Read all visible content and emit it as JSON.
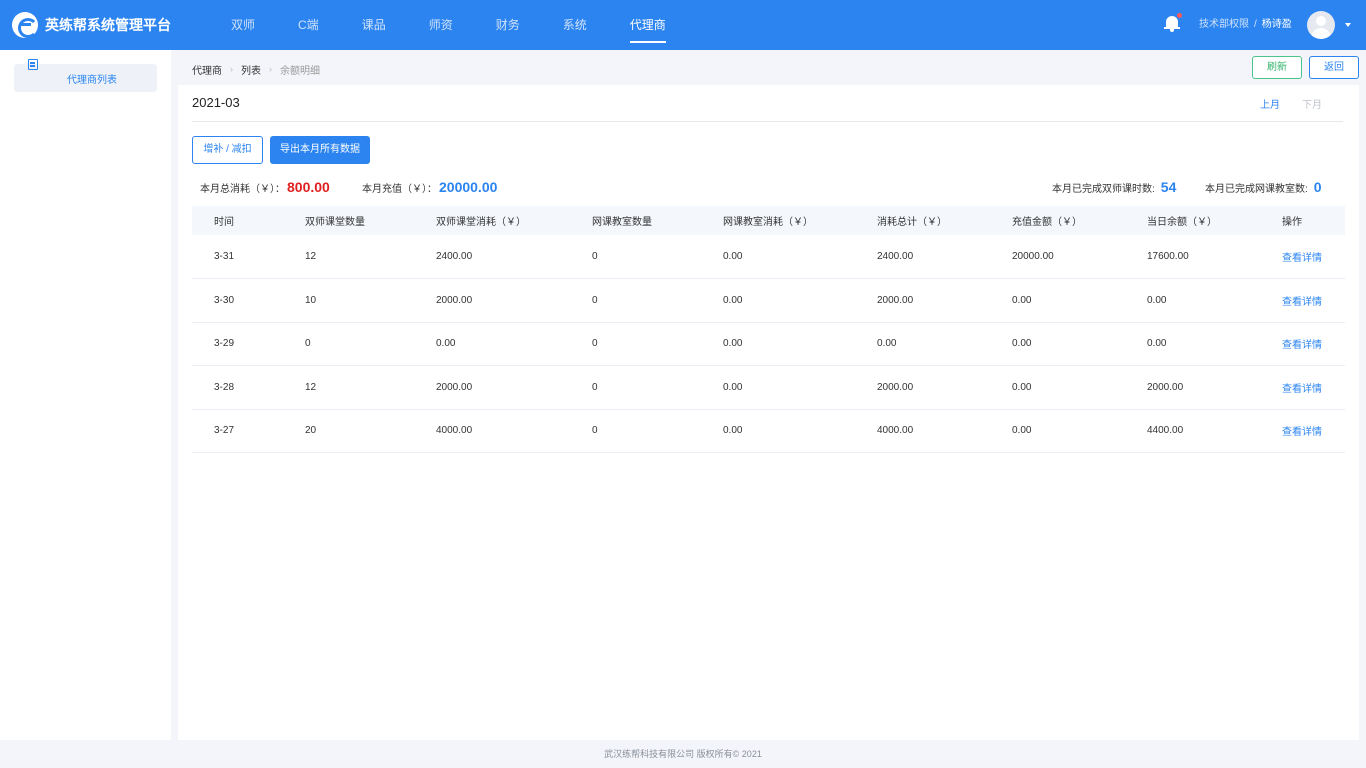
{
  "header": {
    "app_title": "英练帮系统管理平台",
    "nav": [
      {
        "label": "双师",
        "active": false
      },
      {
        "label": "C端",
        "active": false
      },
      {
        "label": "课品",
        "active": false
      },
      {
        "label": "师资",
        "active": false
      },
      {
        "label": "财务",
        "active": false
      },
      {
        "label": "系统",
        "active": false
      },
      {
        "label": "代理商",
        "active": true
      }
    ],
    "permission": "技术部权限",
    "separator": "/",
    "username": "杨诗盈"
  },
  "sidebar": {
    "items": [
      {
        "label": "代理商列表",
        "icon": "list-doc-icon"
      }
    ]
  },
  "breadcrumb": [
    "代理商",
    "列表",
    "余额明细"
  ],
  "actions": {
    "refresh": "刷新",
    "back": "返回"
  },
  "month_bar": {
    "month": "2021-03",
    "prev": "上月",
    "next": "下月"
  },
  "buttons": {
    "adjust": "增补 / 减扣",
    "export": "导出本月所有数据"
  },
  "stats": {
    "total_consume_label": "本月总消耗（￥）：",
    "total_consume_value": "800.00",
    "recharge_label": "本月充值（￥）：",
    "recharge_value": "20000.00",
    "dual_hours_label": "本月已完成双师课时数:",
    "dual_hours_value": "54",
    "online_rooms_label": "本月已完成网课教室数:",
    "online_rooms_value": "0"
  },
  "table": {
    "columns": [
      "时间",
      "双师课堂数量",
      "双师课堂消耗（￥）",
      "网课教室数量",
      "网课教室消耗（￥）",
      "消耗总计（￥）",
      "充值金额（￥）",
      "当日余额（￥）",
      "操作"
    ],
    "rows": [
      [
        "3-31",
        "12",
        "2400.00",
        "0",
        "0.00",
        "2400.00",
        "20000.00",
        "17600.00",
        "查看详情"
      ],
      [
        "3-30",
        "10",
        "2000.00",
        "0",
        "0.00",
        "2000.00",
        "0.00",
        "0.00",
        "查看详情"
      ],
      [
        "3-29",
        "0",
        "0.00",
        "0",
        "0.00",
        "0.00",
        "0.00",
        "0.00",
        "查看详情"
      ],
      [
        "3-28",
        "12",
        "2000.00",
        "0",
        "0.00",
        "2000.00",
        "0.00",
        "2000.00",
        "查看详情"
      ],
      [
        "3-27",
        "20",
        "4000.00",
        "0",
        "0.00",
        "4000.00",
        "0.00",
        "4400.00",
        "查看详情"
      ]
    ]
  },
  "footer": "武汉练帮科技有限公司 版权所有© 2021"
}
